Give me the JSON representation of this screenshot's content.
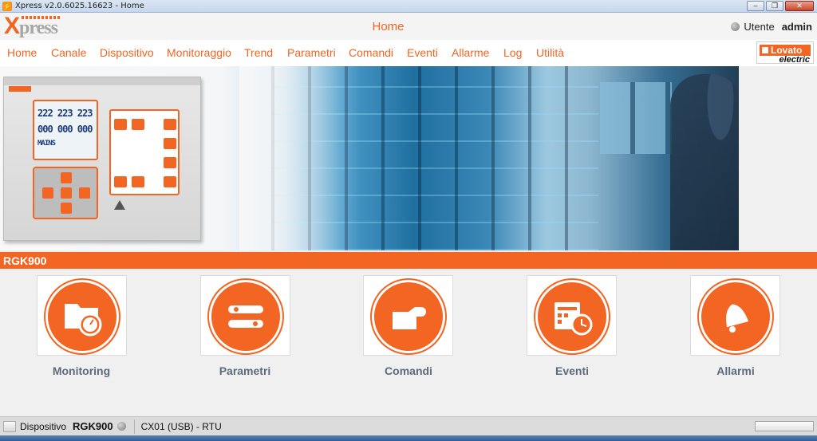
{
  "window": {
    "title": "Xpress v2.0.6025.16623 - Home",
    "buttons": {
      "minimize": "–",
      "maximize": "❐",
      "close": "✕"
    }
  },
  "header": {
    "logo_x": "X",
    "logo_rest": "press",
    "page_title": "Home",
    "user_label": "Utente",
    "user_name": "admin"
  },
  "nav": {
    "items": [
      "Home",
      "Canale",
      "Dispositivo",
      "Monitoraggio",
      "Trend",
      "Parametri",
      "Comandi",
      "Eventi",
      "Allarme",
      "Log",
      "Utilità"
    ]
  },
  "brand": {
    "name": "Lovato",
    "sub": "electric"
  },
  "device_image": {
    "lcd_rows": [
      "222 223 223",
      "000 000 000",
      "MAINS"
    ]
  },
  "device_section": {
    "name": "RGK900"
  },
  "tiles": [
    {
      "label": "Monitoring",
      "icon": "monitoring-icon"
    },
    {
      "label": "Parametri",
      "icon": "parameters-icon"
    },
    {
      "label": "Comandi",
      "icon": "commands-icon"
    },
    {
      "label": "Eventi",
      "icon": "events-icon"
    },
    {
      "label": "Allarmi",
      "icon": "alarms-icon"
    }
  ],
  "statusbar": {
    "device_label": "Dispositivo",
    "device_value": "RGK900",
    "connection": "CX01 (USB) - RTU"
  },
  "colors": {
    "accent": "#f26522",
    "tile_label": "#5c6a7a"
  }
}
